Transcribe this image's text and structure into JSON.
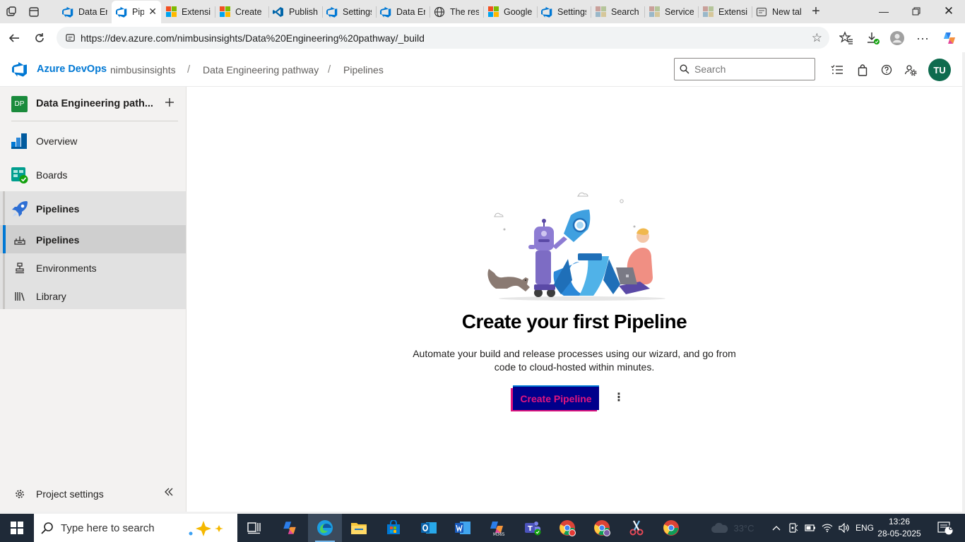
{
  "browser": {
    "tabs": [
      {
        "title": "Data En",
        "icon": "azure-devops-icon"
      },
      {
        "title": "Pip",
        "icon": "azure-devops-icon",
        "active": true
      },
      {
        "title": "Extensic",
        "icon": "microsoft-icon"
      },
      {
        "title": "Create F",
        "icon": "microsoft-icon"
      },
      {
        "title": "Publishi",
        "icon": "vscode-icon"
      },
      {
        "title": "Settings",
        "icon": "azure-devops-icon"
      },
      {
        "title": "Data En",
        "icon": "azure-devops-icon"
      },
      {
        "title": "The reso",
        "icon": "globe-icon"
      },
      {
        "title": "Google",
        "icon": "microsoft-icon"
      },
      {
        "title": "Settings",
        "icon": "azure-devops-icon"
      },
      {
        "title": "Search r",
        "icon": "microsoft-gray-icon"
      },
      {
        "title": "Service",
        "icon": "microsoft-gray-icon"
      },
      {
        "title": "Extensic",
        "icon": "microsoft-gray-icon"
      },
      {
        "title": "New tal",
        "icon": "newtab-icon"
      }
    ],
    "url": "https://dev.azure.com/nimbusinsights/Data%20Engineering%20pathway/_build"
  },
  "header": {
    "brand": "Azure DevOps",
    "breadcrumbs": [
      "nimbusinsights",
      "Data Engineering pathway",
      "Pipelines"
    ],
    "search_placeholder": "Search",
    "avatar_initials": "TU"
  },
  "sidebar": {
    "project_badge": "DP",
    "project_name": "Data Engineering path...",
    "items": [
      {
        "label": "Overview",
        "icon": "overview-icon"
      },
      {
        "label": "Boards",
        "icon": "boards-icon"
      },
      {
        "label": "Pipelines",
        "icon": "pipelines-icon"
      }
    ],
    "subitems": [
      {
        "label": "Pipelines",
        "icon": "pipelines-sub-icon",
        "selected": true
      },
      {
        "label": "Environments",
        "icon": "environments-icon"
      },
      {
        "label": "Library",
        "icon": "library-icon"
      }
    ],
    "footer": "Project settings"
  },
  "main": {
    "title": "Create your first Pipeline",
    "description": "Automate your build and release processes using our wizard, and go from code to cloud-hosted within minutes.",
    "cta_label": "Create Pipeline"
  },
  "taskbar": {
    "search_placeholder": "Type here to search",
    "weather_temp": "33°C",
    "language": "ENG",
    "time": "13:26",
    "date": "28-05-2025",
    "notifications": "8"
  },
  "colors": {
    "accent": "#0078d4",
    "cta_bg": "#00008b",
    "cta_text": "#e0157f",
    "avatar": "#0e6b4e",
    "project_badge": "#1a8b3c"
  }
}
